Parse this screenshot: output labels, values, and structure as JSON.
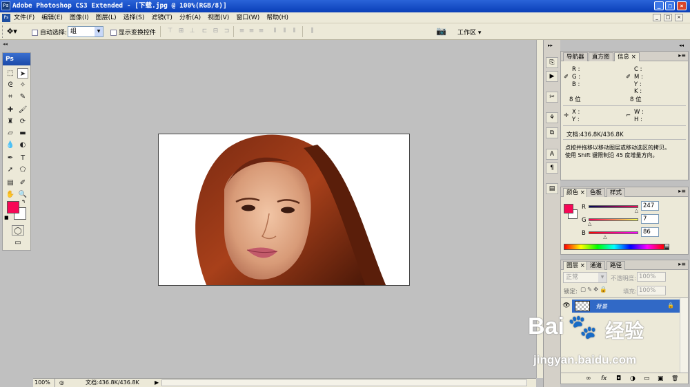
{
  "title_bar": {
    "app_icon": "Ps",
    "title": "Adobe Photoshop CS3 Extended - [下载.jpg @ 100%(RGB/8)]",
    "buttons": [
      "_",
      "□",
      "×"
    ]
  },
  "menu": {
    "app_icon": "Ps",
    "items": [
      "文件(F)",
      "编辑(E)",
      "图像(I)",
      "图层(L)",
      "选择(S)",
      "滤镜(T)",
      "分析(A)",
      "视图(V)",
      "窗口(W)",
      "帮助(H)"
    ],
    "doc_buttons": [
      "_",
      "□",
      "×"
    ]
  },
  "options_bar": {
    "auto_select_label": "自动选择:",
    "auto_select_value": "组",
    "show_transform_label": "显示变换控件",
    "workspace_label": "工作区"
  },
  "toolbox": {
    "header": "Ps",
    "foreground_color": "#f70756",
    "background_color": "#ffffff"
  },
  "document": {
    "file_name": "下载.jpg"
  },
  "status_bar": {
    "zoom": "100%",
    "doc_info": "文档:436.8K/436.8K"
  },
  "info_panel": {
    "tabs": [
      "导航器",
      "直方图",
      "信息"
    ],
    "active_tab": "信息",
    "rgb_labels": [
      "R :",
      "G :",
      "B :"
    ],
    "cmyk_labels": [
      "C :",
      "M :",
      "Y :",
      "K :"
    ],
    "bit_left": "8 位",
    "bit_right": "8 位",
    "xy_labels": [
      "X :",
      "Y :"
    ],
    "wh_labels": [
      "W :",
      "H :"
    ],
    "doc_info": "文档:436.8K/436.8K",
    "hint_line1": "点按并拖移以移动图层或移动选区的拷贝。",
    "hint_line2": "使用 Shift 键限制沿 45 度增量方向。"
  },
  "color_panel": {
    "tabs": [
      "颜色",
      "色板",
      "样式"
    ],
    "active_tab": "颜色",
    "r_label": "R",
    "g_label": "G",
    "b_label": "B",
    "r_value": "247",
    "g_value": "7",
    "b_value": "86",
    "r_level": 0.969,
    "g_level": 0.027,
    "b_level": 0.337,
    "swatch_color": "#f70756"
  },
  "layers_panel": {
    "tabs": [
      "图层",
      "通道",
      "路径"
    ],
    "active_tab": "图层",
    "blend_mode": "正常",
    "opacity_label": "不透明度:",
    "opacity_value": "100%",
    "lock_label": "锁定:",
    "fill_label": "填充:",
    "fill_value": "100%",
    "layer_name": "背景",
    "footer_icons": [
      "∞",
      "fx",
      "◘",
      "◑",
      "▭",
      "▣",
      "🗑"
    ]
  },
  "watermark": {
    "brand": "Bai",
    "brand_cn": "经验",
    "url": "jingyan.baidu.com"
  }
}
